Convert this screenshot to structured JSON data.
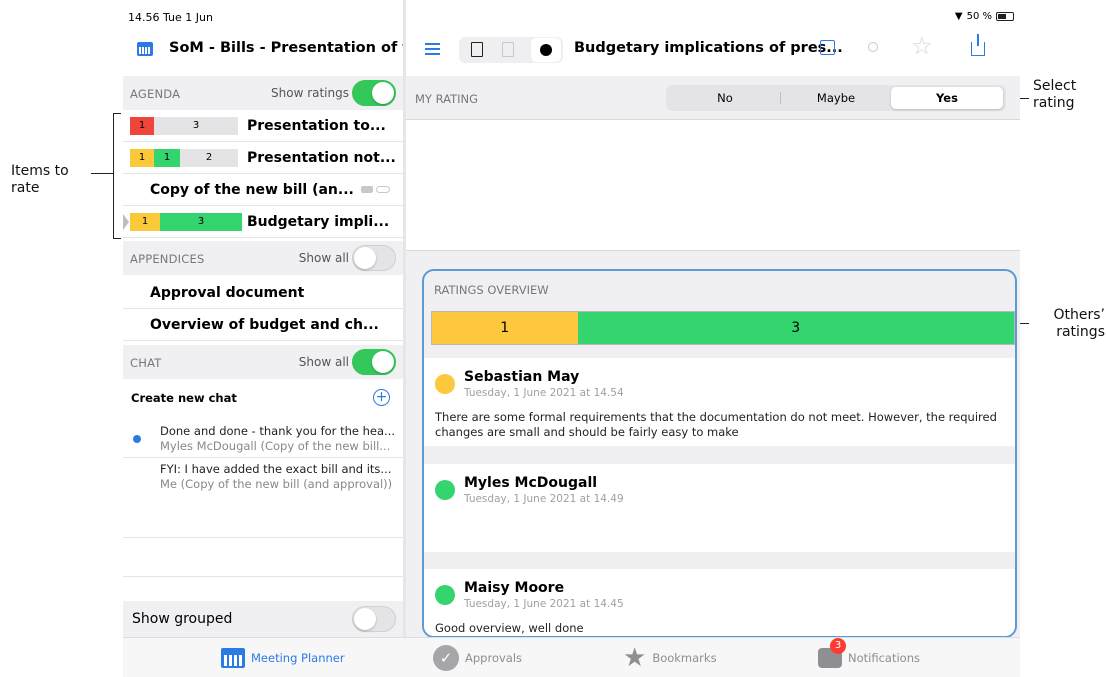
{
  "status": {
    "time": "14.56 Tue 1 Jun",
    "battery": "50 %"
  },
  "meeting": {
    "title": "SoM - Bills - Presentation of th..."
  },
  "agenda": {
    "header": "AGENDA",
    "toggle_label": "Show ratings",
    "toggle_on": true,
    "items": [
      {
        "title": "Presentation to...",
        "ratings": [
          {
            "value": "1",
            "color": "#f0453a"
          },
          {
            "value": "3",
            "color": "#e4e4e6"
          }
        ]
      },
      {
        "title": "Presentation not...",
        "ratings": [
          {
            "value": "1",
            "color": "#f9c93a"
          },
          {
            "value": "1",
            "color": "#34d46e"
          },
          {
            "value": "2",
            "color": "#e4e4e6"
          }
        ]
      },
      {
        "title": "Copy of the new bill (an...",
        "ratings": []
      },
      {
        "title": "Budgetary impli...",
        "ratings": [
          {
            "value": "1",
            "color": "#f9c93a"
          },
          {
            "value": "3",
            "color": "#34d46e"
          }
        ]
      }
    ]
  },
  "appendices": {
    "header": "APPENDICES",
    "toggle_label": "Show all",
    "toggle_on": false,
    "items": [
      "Approval document",
      "Overview of budget and ch..."
    ]
  },
  "chat": {
    "header": "CHAT",
    "toggle_label": "Show all",
    "toggle_on": true,
    "create_label": "Create new chat",
    "items": [
      {
        "line1": "Done and done - thank you for the hea...",
        "line2": "Myles McDougall (Copy of the new bill...",
        "unread": true
      },
      {
        "line1": "FYI: I have added the exact bill and its...",
        "line2": "Me (Copy of the new bill (and approval))",
        "unread": false
      }
    ]
  },
  "show_grouped": {
    "label": "Show grouped",
    "on": false
  },
  "document": {
    "title": "Budgetary implications of pres..."
  },
  "my_rating": {
    "label": "MY RATING",
    "options": [
      "No",
      "Maybe",
      "Yes"
    ],
    "selected": "Yes"
  },
  "overview": {
    "label": "RATINGS OVERVIEW",
    "bar": [
      {
        "value": "1",
        "color": "#fec83d",
        "share": 0.25
      },
      {
        "value": "3",
        "color": "#34d46e",
        "share": 0.75
      }
    ],
    "ratings": [
      {
        "name": "Sebastian May",
        "date": "Tuesday, 1 June 2021 at 14.54",
        "color": "#fec83d",
        "comment": "There are some formal requirements that the documentation do not meet. However, the required changes are small and should be fairly easy to make"
      },
      {
        "name": "Myles McDougall",
        "date": "Tuesday, 1 June 2021 at 14.49",
        "color": "#34d46e",
        "comment": ""
      },
      {
        "name": "Maisy Moore",
        "date": "Tuesday, 1 June 2021 at 14.45",
        "color": "#34d46e",
        "comment": "Good overview, well done"
      }
    ]
  },
  "tabs": [
    {
      "label": "Meeting Planner",
      "icon": "calendar-icon",
      "active": true
    },
    {
      "label": "Approvals",
      "icon": "approvals-check-icon",
      "active": false
    },
    {
      "label": "Bookmarks",
      "icon": "star-icon",
      "active": false
    },
    {
      "label": "Notifications",
      "icon": "chat-bubble-icon",
      "active": false,
      "badge": "3"
    }
  ],
  "annotations": {
    "items_to_rate": "Items to rate",
    "select_rating": "Select rating",
    "others_ratings": "Others’ ratings"
  }
}
